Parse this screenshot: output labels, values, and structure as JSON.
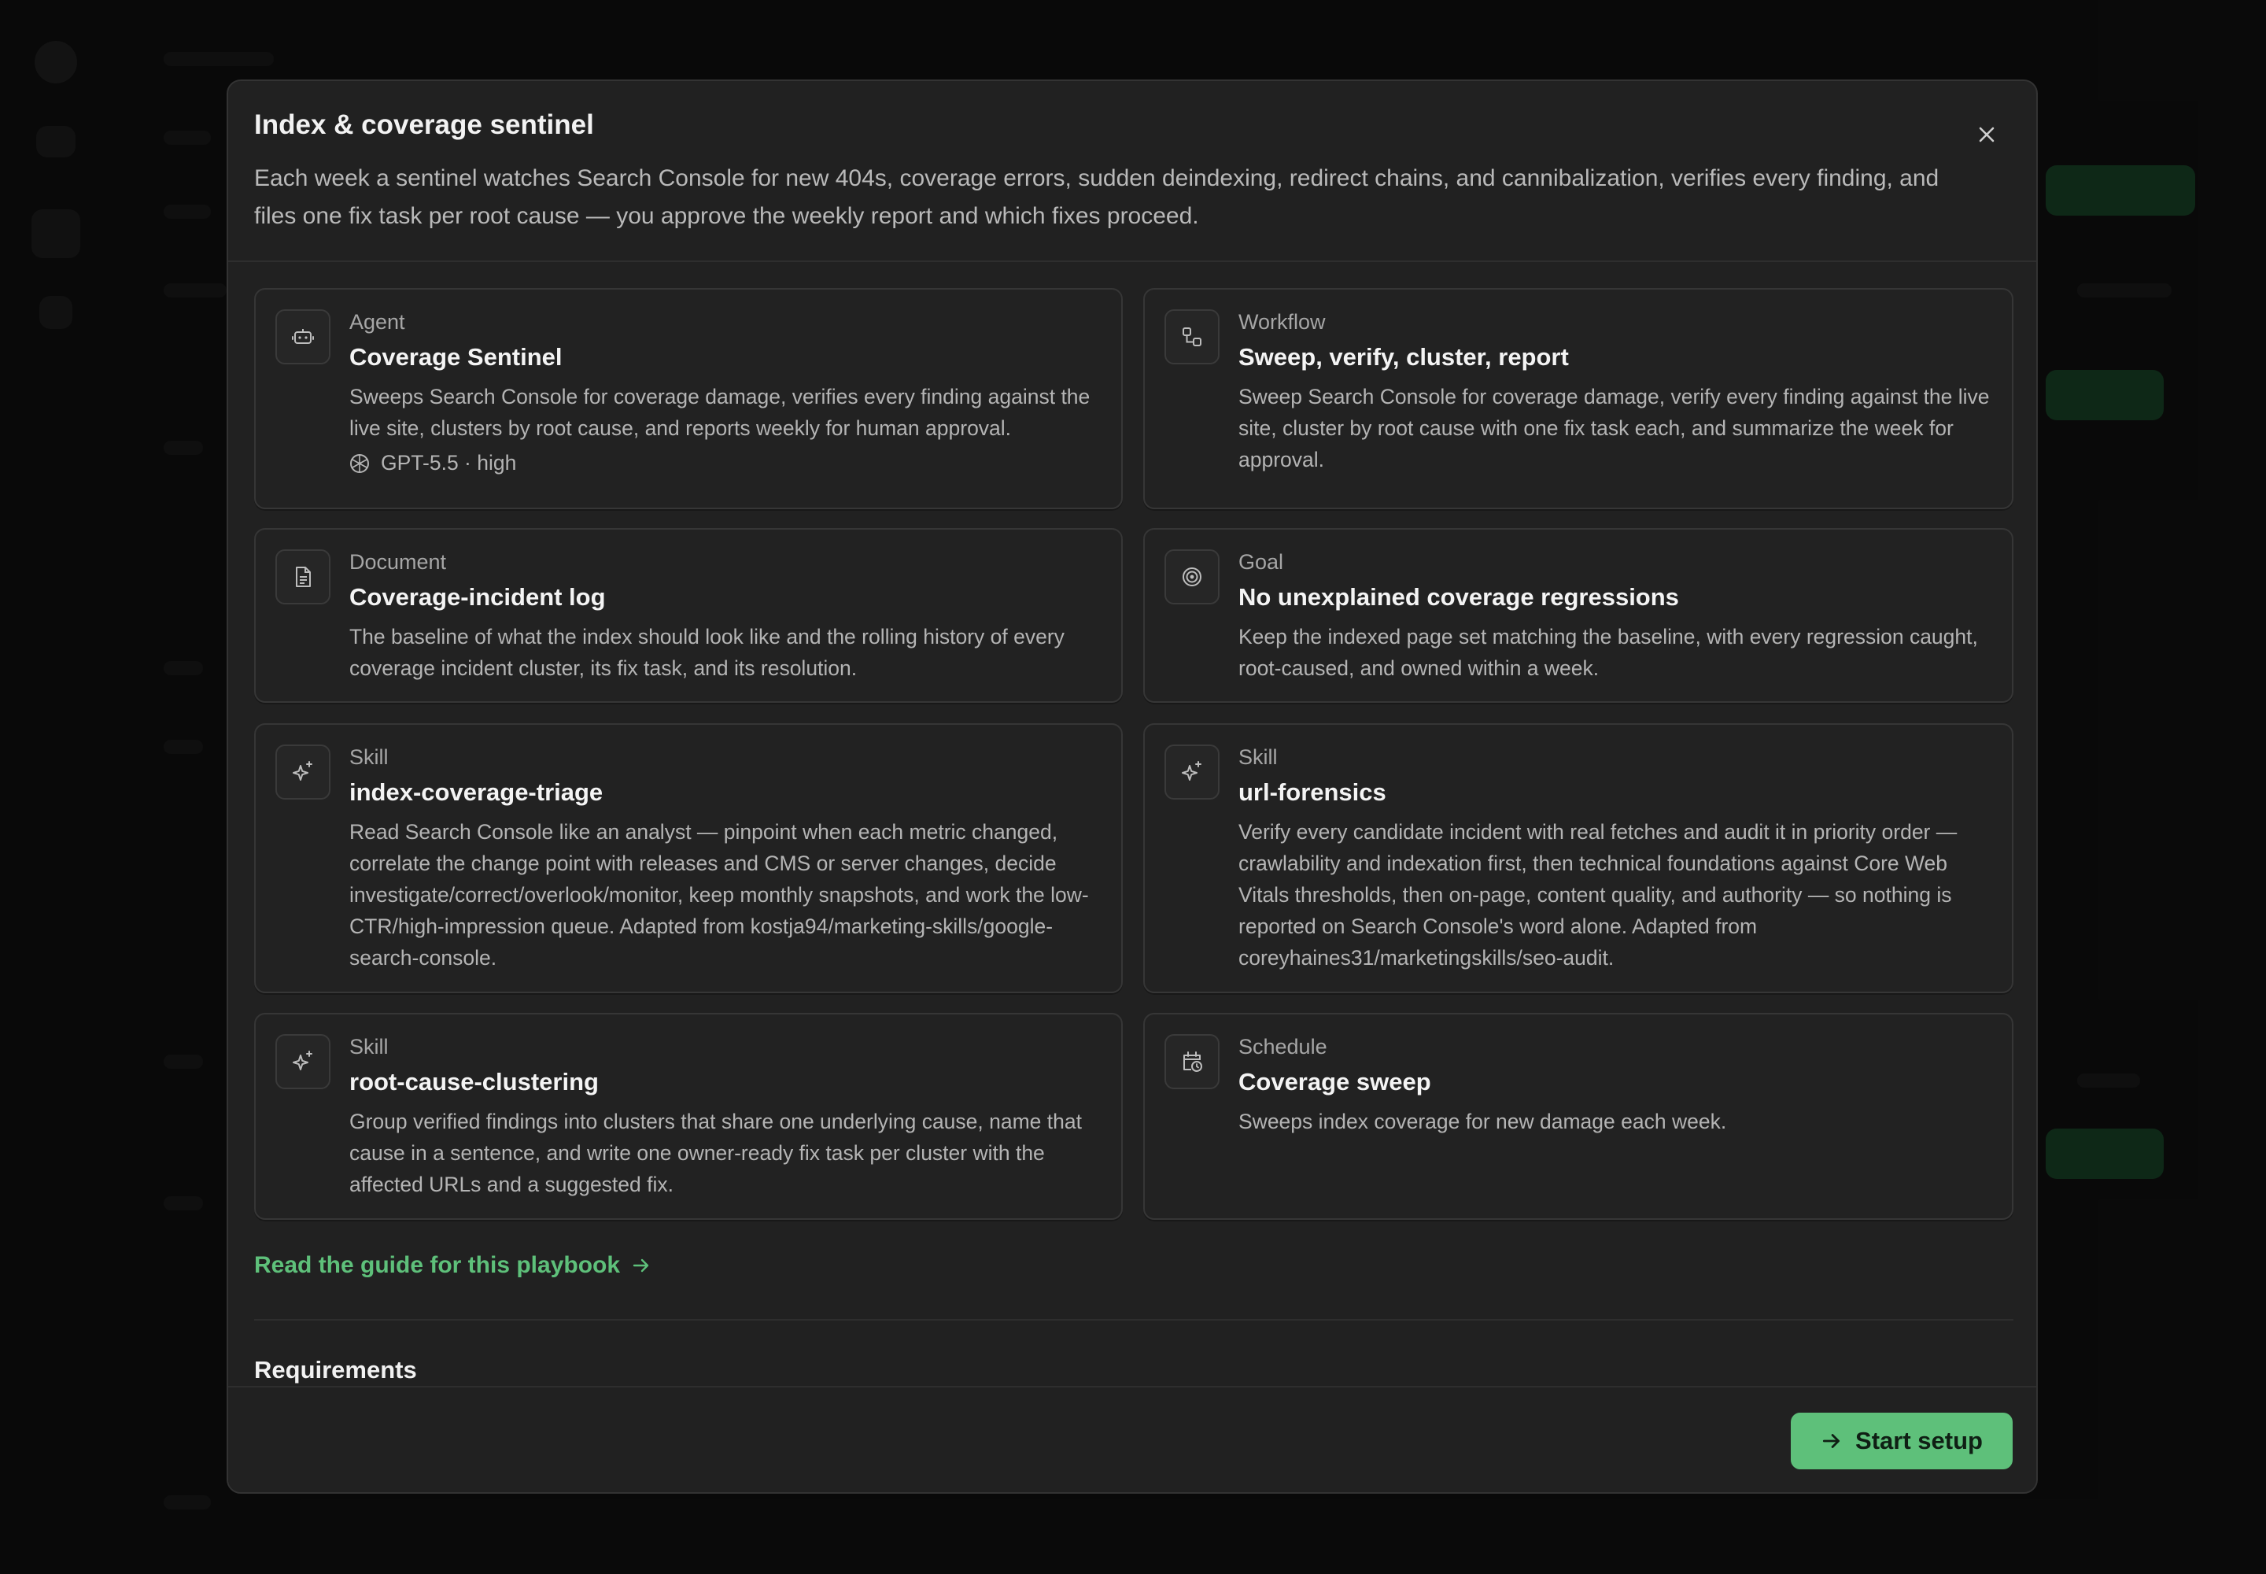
{
  "modal": {
    "title": "Index & coverage sentinel",
    "description": "Each week a sentinel watches Search Console for new 404s, coverage errors, sudden deindexing, redirect chains, and cannibalization, verifies every finding, and files one fix task per root cause — you approve the weekly report and which fixes proceed.",
    "close_icon": "close-icon"
  },
  "cards": [
    {
      "type": "Agent",
      "title": "Coverage Sentinel",
      "description": "Sweeps Search Console for coverage damage, verifies every finding against the live site, clusters by root cause, and reports weekly for human approval.",
      "icon": "robot-icon",
      "meta": "GPT-5.5 · high",
      "meta_icon": "model-icon"
    },
    {
      "type": "Workflow",
      "title": "Sweep, verify, cluster, report",
      "description": "Sweep Search Console for coverage damage, verify every finding against the live site, cluster by root cause with one fix task each, and summarize the week for approval.",
      "icon": "workflow-icon"
    },
    {
      "type": "Document",
      "title": "Coverage-incident log",
      "description": "The baseline of what the index should look like and the rolling history of every coverage incident cluster, its fix task, and its resolution.",
      "icon": "document-icon"
    },
    {
      "type": "Goal",
      "title": "No unexplained coverage regressions",
      "description": "Keep the indexed page set matching the baseline, with every regression caught, root-caused, and owned within a week.",
      "icon": "target-icon"
    },
    {
      "type": "Skill",
      "title": "index-coverage-triage",
      "description": "Read Search Console like an analyst — pinpoint when each metric changed, correlate the change point with releases and CMS or server changes, decide investigate/correct/overlook/monitor, keep monthly snapshots, and work the low-CTR/high-impression queue. Adapted from kostja94/marketing-skills/google-search-console.",
      "icon": "sparkle-icon"
    },
    {
      "type": "Skill",
      "title": "url-forensics",
      "description": "Verify every candidate incident with real fetches and audit it in priority order — crawlability and indexation first, then technical foundations against Core Web Vitals thresholds, then on-page, content quality, and authority — so nothing is reported on Search Console's word alone. Adapted from coreyhaines31/marketingskills/seo-audit.",
      "icon": "sparkle-icon"
    },
    {
      "type": "Skill",
      "title": "root-cause-clustering",
      "description": "Group verified findings into clusters that share one underlying cause, name that cause in a sentence, and write one owner-ready fix task per cluster with the affected URLs and a suggested fix.",
      "icon": "sparkle-icon"
    },
    {
      "type": "Schedule",
      "title": "Coverage sweep",
      "description": "Sweeps index coverage for new damage each week.",
      "icon": "calendar-clock-icon"
    }
  ],
  "guide_link": {
    "label": "Read the guide for this playbook",
    "icon": "arrow-right-icon"
  },
  "requirements": {
    "title": "Requirements"
  },
  "footer": {
    "start_label": "Start setup",
    "start_icon": "arrow-right-icon"
  },
  "colors": {
    "accent": "#5ec07a",
    "modal_bg": "#212121",
    "card_border": "#363636"
  }
}
